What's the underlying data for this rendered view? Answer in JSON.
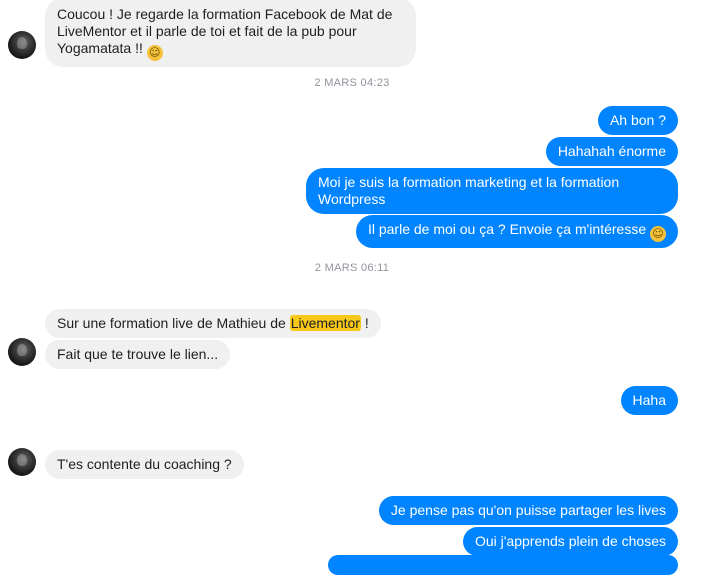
{
  "conversation": {
    "messages": [
      {
        "id": "m1",
        "side": "in",
        "text": "Coucou ! Je regarde la formation Facebook de Mat de LiveMentor et il parle de toi et fait de la pub pour Yogamatata !!",
        "emoji": "grinning-sweat-face"
      },
      {
        "id": "stamp1",
        "text": "2 MARS 04:23"
      },
      {
        "id": "m2",
        "side": "out",
        "text": "Ah bon ?"
      },
      {
        "id": "m3",
        "side": "out",
        "text": "Hahahah énorme"
      },
      {
        "id": "m4",
        "side": "out",
        "text": "Moi je suis la formation marketing et la formation Wordpress"
      },
      {
        "id": "m5",
        "side": "out",
        "text": "Il parle de moi ou ça ? Envoie ça m'intéresse",
        "emoji": "smiling-face"
      },
      {
        "id": "stamp2",
        "text": "2 MARS 06:11"
      },
      {
        "id": "m6",
        "side": "in",
        "text_before": "Sur une formation  live de Mathieu de",
        "highlight": "Livementor",
        "text_after": "!"
      },
      {
        "id": "m7",
        "side": "in",
        "text": "Fait que te trouve le lien..."
      },
      {
        "id": "m8",
        "side": "out",
        "text": "Haha"
      },
      {
        "id": "m9",
        "side": "in",
        "text": "T'es contente du coaching ?"
      },
      {
        "id": "m10",
        "side": "out",
        "text": "Je pense pas qu'on puisse partager les lives"
      },
      {
        "id": "m11",
        "side": "out",
        "text": "Oui j'apprends plein de choses"
      }
    ],
    "m1_lines": [
      "Coucou ! Je regarde la formation Facebook de Mat de",
      "LiveMentor et il parle de toi et fait de la pub pour",
      "Yogamatata !!"
    ],
    "m4_lines": [
      "Moi je suis la formation marketing et la formation",
      "Wordpress"
    ]
  },
  "colors": {
    "incoming_bubble": "#f1f0f0",
    "outgoing_bubble": "#0084ff",
    "timestamp": "#90949c",
    "highlight": "#f7c719"
  }
}
